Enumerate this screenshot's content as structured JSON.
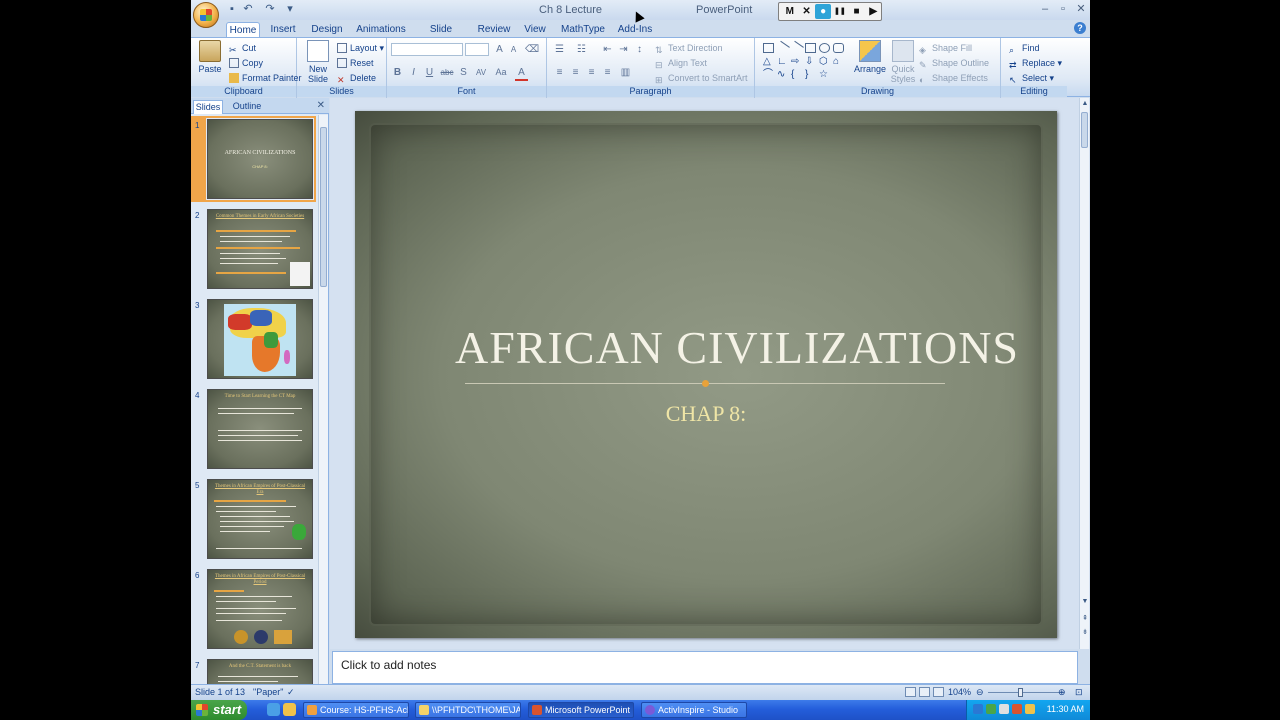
{
  "window": {
    "title_left": "Ch 8 Lecture",
    "title_right": "PowerPoint"
  },
  "recorder": {
    "buttons": [
      "M",
      "✕",
      "●",
      "❚❚",
      "■",
      "▶"
    ]
  },
  "tabs": [
    "Home",
    "Insert",
    "Design",
    "Animations",
    "Slide Show",
    "Review",
    "View",
    "MathType",
    "Add-Ins"
  ],
  "ribbon": {
    "clipboard": {
      "label": "Clipboard",
      "paste": "Paste",
      "cut": "Cut",
      "copy": "Copy",
      "format_painter": "Format Painter"
    },
    "slides": {
      "label": "Slides",
      "new_slide_1": "New",
      "new_slide_2": "Slide",
      "layout": "Layout",
      "reset": "Reset",
      "delete": "Delete"
    },
    "font": {
      "label": "Font",
      "bold": "B",
      "italic": "I",
      "underline": "U",
      "strike": "abc",
      "shadow": "S",
      "spacing": "AV",
      "case": "Aa",
      "color": "A",
      "grow": "A",
      "shrink": "A"
    },
    "paragraph": {
      "label": "Paragraph",
      "text_direction": "Text Direction",
      "align_text": "Align Text",
      "convert_smartart": "Convert to SmartArt"
    },
    "drawing": {
      "label": "Drawing",
      "arrange": "Arrange",
      "quick_styles_1": "Quick",
      "quick_styles_2": "Styles",
      "shape_fill": "Shape Fill",
      "shape_outline": "Shape Outline",
      "shape_effects": "Shape Effects"
    },
    "editing": {
      "label": "Editing",
      "find": "Find",
      "replace": "Replace",
      "select": "Select"
    }
  },
  "left_pane": {
    "tab_slides": "Slides",
    "tab_outline": "Outline",
    "thumbnails": [
      {
        "num": "1",
        "title": "AFRICAN CIVILIZATIONS",
        "body": "CHAP 8:"
      },
      {
        "num": "2",
        "title": "Common Themes in Early African Societies",
        "body": ""
      },
      {
        "num": "3",
        "title": "",
        "body": ""
      },
      {
        "num": "4",
        "title": "Time to Start Learning the CT Map",
        "body": ""
      },
      {
        "num": "5",
        "title": "Themes in African Empires of Post-Classical Era",
        "body": ""
      },
      {
        "num": "6",
        "title": "Themes in African Empires of Post-Classical Period",
        "body": ""
      },
      {
        "num": "7",
        "title": "And the C.T. Statement is back",
        "body": ""
      }
    ]
  },
  "slide": {
    "title": "AFRICAN CIVILIZATIONS",
    "subtitle": "CHAP 8:"
  },
  "notes": {
    "placeholder": "Click to add notes"
  },
  "status": {
    "slide_of": "Slide 1 of 13",
    "theme": "\"Paper\"",
    "zoom": "104%"
  },
  "taskbar": {
    "start": "start",
    "items": [
      "Course: HS-PFHS-Ack...",
      "\\\\PFHTDC\\THOME\\JA...",
      "Microsoft PowerPoint ...",
      "ActivInspire - Studio"
    ],
    "clock": "11:30 AM"
  },
  "colors": {
    "ribbon_text": "#15428b",
    "slide_title": "#f4f2e6",
    "slide_subtitle": "#efe5a6",
    "accent_dot": "#e8a23a",
    "selection_outline": "#f0a54a"
  }
}
